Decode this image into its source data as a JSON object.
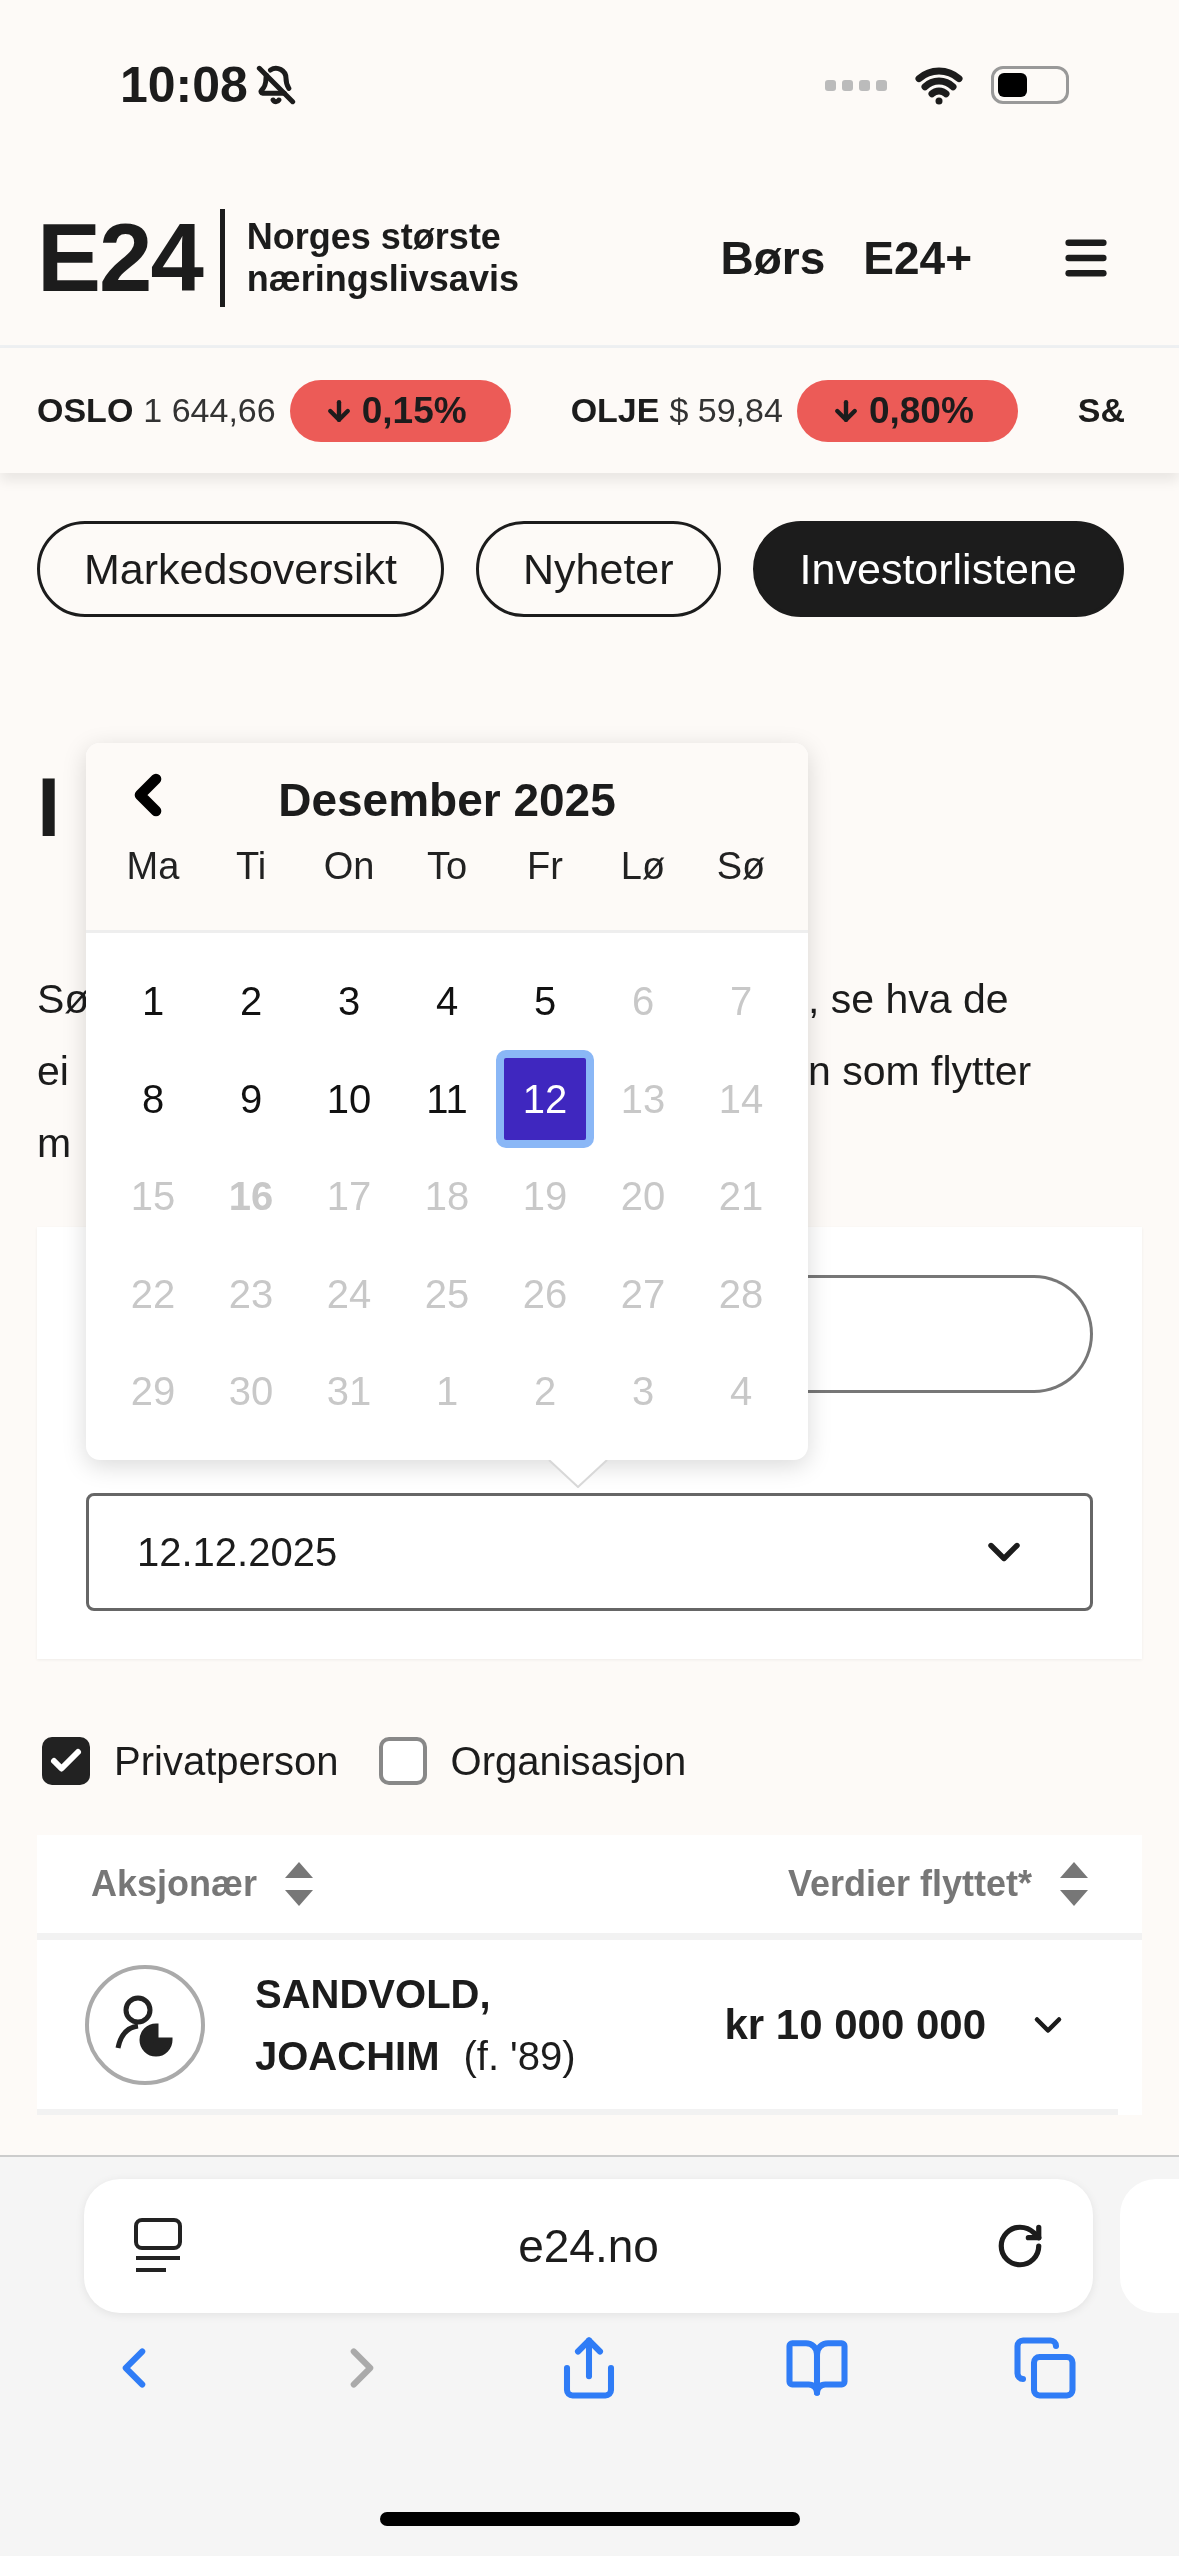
{
  "status_bar": {
    "time": "10:08",
    "silent": true
  },
  "header": {
    "logo": "E24",
    "tagline": "Norges største næringslivsavis",
    "nav": [
      "Børs",
      "E24+"
    ]
  },
  "ticker": [
    {
      "name": "OSLO",
      "value": "1 644,66",
      "change": "0,15%",
      "down": true
    },
    {
      "name": "OLJE",
      "value": "$ 59,84",
      "change": "0,80%",
      "down": true
    },
    {
      "name": "S&"
    }
  ],
  "tabs": [
    {
      "label": "Markedsoversikt",
      "selected": false
    },
    {
      "label": "Nyheter",
      "selected": false
    },
    {
      "label": "Investorlistene",
      "selected": true
    }
  ],
  "heading": "I",
  "intro": [
    {
      "left": "Sø",
      "right": ", se hva de"
    },
    {
      "left": "ei",
      "right": "n som flytter"
    },
    {
      "left": "m"
    }
  ],
  "calendar": {
    "month": "Desember 2025",
    "weekdays": [
      "Ma",
      "Ti",
      "On",
      "To",
      "Fr",
      "Lø",
      "Sø"
    ],
    "days": [
      {
        "label": "1",
        "disabled": false,
        "selected": false,
        "today": false
      },
      {
        "label": "2",
        "disabled": false,
        "selected": false,
        "today": false
      },
      {
        "label": "3",
        "disabled": false,
        "selected": false,
        "today": false
      },
      {
        "label": "4",
        "disabled": false,
        "selected": false,
        "today": false
      },
      {
        "label": "5",
        "disabled": false,
        "selected": false,
        "today": false
      },
      {
        "label": "6",
        "disabled": true,
        "selected": false,
        "today": false
      },
      {
        "label": "7",
        "disabled": true,
        "selected": false,
        "today": false
      },
      {
        "label": "8",
        "disabled": false,
        "selected": false,
        "today": false
      },
      {
        "label": "9",
        "disabled": false,
        "selected": false,
        "today": false
      },
      {
        "label": "10",
        "disabled": false,
        "selected": false,
        "today": false
      },
      {
        "label": "11",
        "disabled": false,
        "selected": false,
        "today": false
      },
      {
        "label": "12",
        "disabled": false,
        "selected": true,
        "today": false
      },
      {
        "label": "13",
        "disabled": true,
        "selected": false,
        "today": false
      },
      {
        "label": "14",
        "disabled": true,
        "selected": false,
        "today": false
      },
      {
        "label": "15",
        "disabled": true,
        "selected": false,
        "today": false
      },
      {
        "label": "16",
        "disabled": true,
        "selected": false,
        "today": true
      },
      {
        "label": "17",
        "disabled": true,
        "selected": false,
        "today": false
      },
      {
        "label": "18",
        "disabled": true,
        "selected": false,
        "today": false
      },
      {
        "label": "19",
        "disabled": true,
        "selected": false,
        "today": false
      },
      {
        "label": "20",
        "disabled": true,
        "selected": false,
        "today": false
      },
      {
        "label": "21",
        "disabled": true,
        "selected": false,
        "today": false
      },
      {
        "label": "22",
        "disabled": true,
        "selected": false,
        "today": false
      },
      {
        "label": "23",
        "disabled": true,
        "selected": false,
        "today": false
      },
      {
        "label": "24",
        "disabled": true,
        "selected": false,
        "today": false
      },
      {
        "label": "25",
        "disabled": true,
        "selected": false,
        "today": false
      },
      {
        "label": "26",
        "disabled": true,
        "selected": false,
        "today": false
      },
      {
        "label": "27",
        "disabled": true,
        "selected": false,
        "today": false
      },
      {
        "label": "28",
        "disabled": true,
        "selected": false,
        "today": false
      },
      {
        "label": "29",
        "disabled": true,
        "selected": false,
        "today": false
      },
      {
        "label": "30",
        "disabled": true,
        "selected": false,
        "today": false
      },
      {
        "label": "31",
        "disabled": true,
        "selected": false,
        "today": false
      },
      {
        "label": "1",
        "disabled": true,
        "selected": false,
        "today": false
      },
      {
        "label": "2",
        "disabled": true,
        "selected": false,
        "today": false
      },
      {
        "label": "3",
        "disabled": true,
        "selected": false,
        "today": false
      },
      {
        "label": "4",
        "disabled": true,
        "selected": false,
        "today": false
      }
    ]
  },
  "date_select": {
    "value": "12.12.2025"
  },
  "filters": [
    {
      "label": "Privatperson",
      "checked": true
    },
    {
      "label": "Organisasjon",
      "checked": false
    }
  ],
  "table": {
    "columns": [
      "Aksjonær",
      "Verdier flyttet*"
    ],
    "rows": [
      {
        "name": "SANDVOLD, JOACHIM",
        "born": "(f. '89)",
        "value": "kr 10 000 000"
      }
    ]
  },
  "browser": {
    "url": "e24.no",
    "nav": [
      {
        "kind": "back",
        "disabled": false
      },
      {
        "kind": "forward",
        "disabled": true
      },
      {
        "kind": "share",
        "disabled": false
      },
      {
        "kind": "bookmarks",
        "disabled": false
      },
      {
        "kind": "tabs",
        "disabled": false
      }
    ]
  }
}
